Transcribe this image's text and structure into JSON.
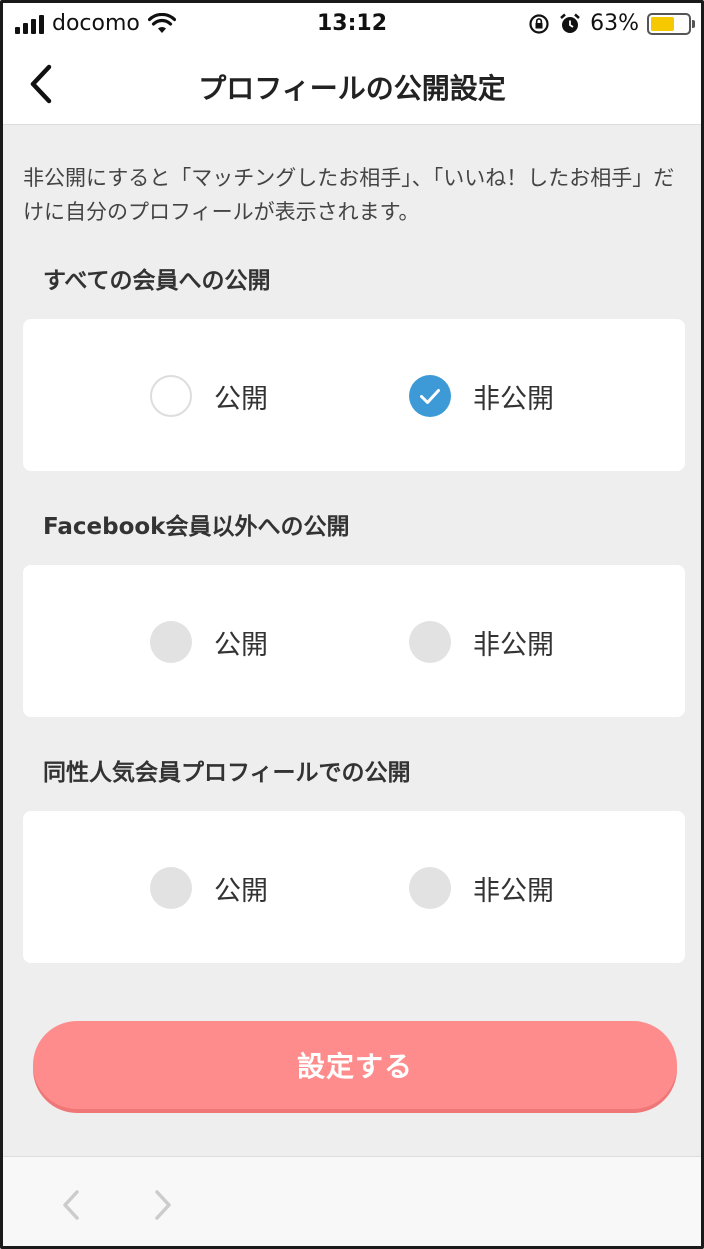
{
  "status_bar": {
    "carrier": "docomo",
    "time": "13:12",
    "battery": "63%",
    "battery_level": 0.63
  },
  "nav": {
    "title": "プロフィールの公開設定"
  },
  "intro": {
    "text": "非公開にすると「マッチングしたお相手」、「いいね！したお相手」だけに自分のプロフィールが表示されます。"
  },
  "sections": [
    {
      "label": "すべての会員への公開",
      "options": [
        {
          "label": "公開",
          "state": "unchecked"
        },
        {
          "label": "非公開",
          "state": "checked"
        }
      ]
    },
    {
      "label": "Facebook会員以外への公開",
      "options": [
        {
          "label": "公開",
          "state": "disabled"
        },
        {
          "label": "非公開",
          "state": "disabled"
        }
      ]
    },
    {
      "label": "同性人気会員プロフィールでの公開",
      "options": [
        {
          "label": "公開",
          "state": "disabled"
        },
        {
          "label": "非公開",
          "state": "disabled"
        }
      ]
    }
  ],
  "submit": {
    "label": "設定する"
  },
  "colors": {
    "accent": "#3d9ad6",
    "submit": "#ff8c8c",
    "background": "#eeeeee",
    "battery": "#f5c800"
  },
  "icons": {
    "back": "chevron-left-icon",
    "toolbar_back": "chevron-left-icon",
    "toolbar_forward": "chevron-right-icon"
  }
}
